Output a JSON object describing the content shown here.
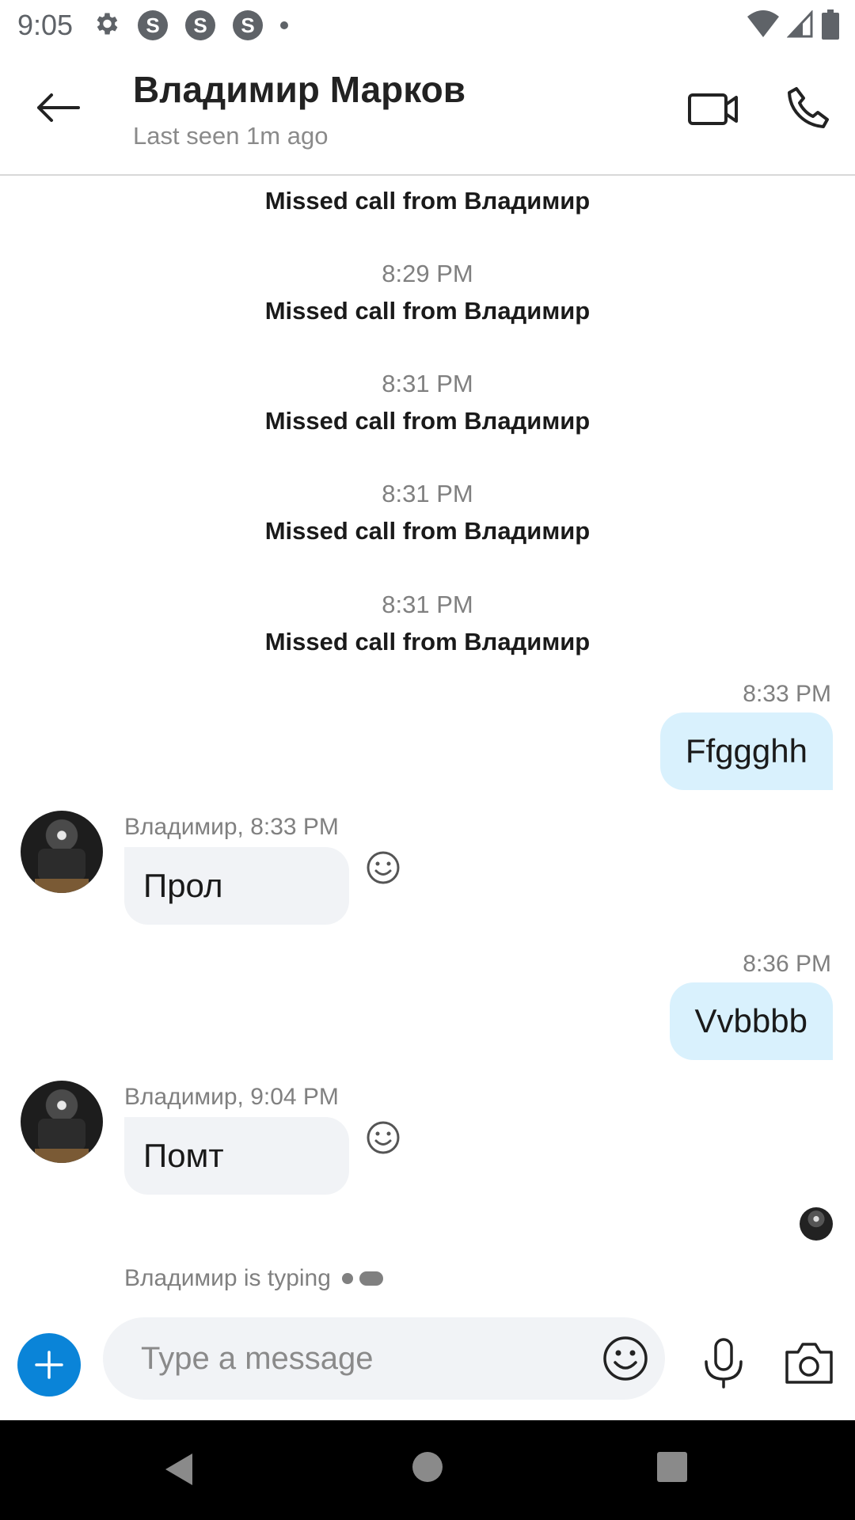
{
  "status_bar": {
    "time": "9:05",
    "badges": [
      "S",
      "S",
      "S"
    ],
    "icons": [
      "settings-icon",
      "skype-icon",
      "wifi-icon",
      "signal-icon",
      "battery-icon"
    ]
  },
  "header": {
    "contact_name": "Владимир Марков",
    "last_seen": "Last seen 1m ago",
    "icons": [
      "back-arrow-icon",
      "video-call-icon",
      "phone-icon"
    ]
  },
  "messages": {
    "system": [
      {
        "time": "",
        "text": "Missed call from Владимир"
      },
      {
        "time": "8:29 PM",
        "text": "Missed call from Владимир"
      },
      {
        "time": "8:31 PM",
        "text": "Missed call from Владимир"
      },
      {
        "time": "8:31 PM",
        "text": "Missed call from Владимир"
      },
      {
        "time": "8:31 PM",
        "text": "Missed call from Владимир"
      }
    ],
    "out_1": {
      "time": "8:33 PM",
      "text": "Ffggghh"
    },
    "in_1": {
      "meta": "Владимир, 8:33 PM",
      "text": "Прол"
    },
    "out_2": {
      "time": "8:36 PM",
      "text": "Vvbbbb"
    },
    "in_2": {
      "meta": "Владимир, 9:04 PM",
      "text": "Помт"
    },
    "typing": "Владимир is typing"
  },
  "composer": {
    "placeholder": "Type a message",
    "icons": [
      "add-icon",
      "emoji-icon",
      "microphone-icon",
      "camera-icon"
    ]
  },
  "colors": {
    "accent": "#0a84d8",
    "outgoing_bubble": "#d9f1fd",
    "incoming_bubble": "#f1f3f6"
  }
}
